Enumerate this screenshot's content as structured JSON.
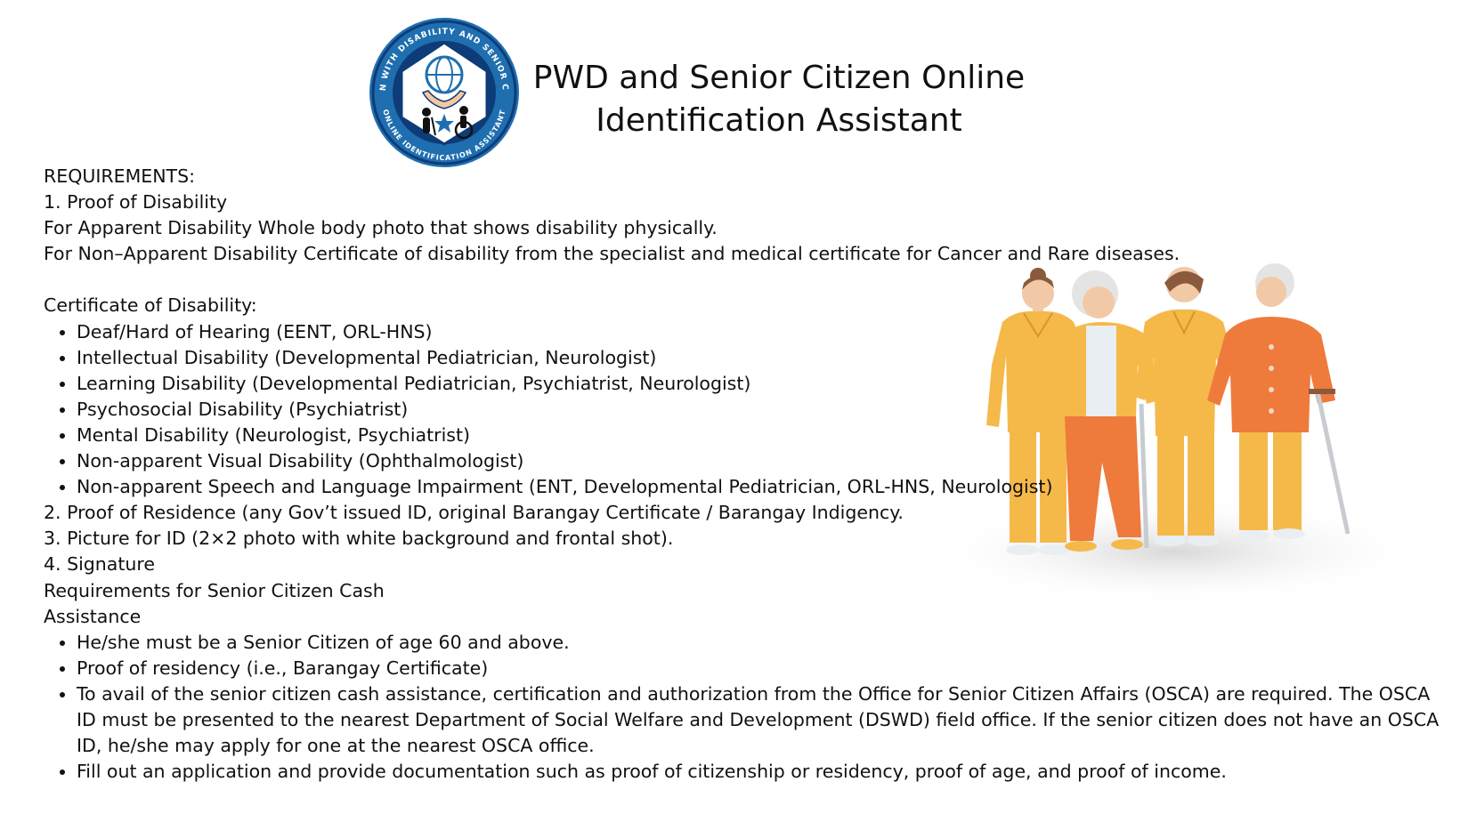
{
  "logo": {
    "ring_text_top": "PERSON WITH DISABILITY AND SENIOR CITIZEN",
    "ring_text_bottom": "ONLINE IDENTIFICATION ASSISTANT",
    "colors": {
      "ring": "#1f6fb0",
      "inner": "#0e3c78",
      "hexagon": "#ffffff",
      "hands": "#f4c9a0"
    }
  },
  "title": {
    "line1": "PWD and Senior Citizen Online",
    "line2": "Identification Assistant"
  },
  "requirements": {
    "heading": "REQUIREMENTS:",
    "item1": "1. Proof of Disability",
    "apparent": "For Apparent Disability Whole body photo that shows disability physically.",
    "non_apparent": "For Non–Apparent Disability Certificate of disability from the specialist and medical certificate for Cancer and Rare diseases.",
    "certificate_heading": "Certificate of Disability:",
    "certificate_items": [
      "Deaf/Hard of Hearing (EENT, ORL-HNS)",
      "Intellectual Disability (Developmental Pediatrician, Neurologist)",
      "Learning Disability (Developmental Pediatrician, Psychiatrist, Neurologist)",
      "Psychosocial Disability (Psychiatrist)",
      "Mental Disability (Neurologist, Psychiatrist)",
      "Non-apparent Visual Disability (Ophthalmologist)",
      "Non-apparent Speech and Language Impairment (ENT, Developmental Pediatrician, ORL-HNS, Neurologist)"
    ],
    "item2": "2. Proof of Residence (any Gov’t issued ID, original Barangay Certificate / Barangay Indigency.",
    "item3": "3. Picture for ID (2×2 photo with white background and frontal shot).",
    "item4": "4. Signature"
  },
  "senior": {
    "heading_line1": "Requirements for Senior Citizen Cash",
    "heading_line2": "Assistance",
    "items": [
      "He/she must be a Senior Citizen of age 60 and above.",
      "Proof of residency (i.e., Barangay Certificate)",
      "To avail of the senior citizen cash assistance, certification and authorization from the Office for Senior Citizen Affairs (OSCA) are required. The OSCA ID must be presented to the nearest Department of Social Welfare and Development (DSWD) field office. If the senior citizen does not have an OSCA ID, he/she may apply for one at the nearest OSCA office.",
      "Fill out an application and provide documentation such as proof of citizenship or residency, proof of age, and proof of income."
    ]
  },
  "illustration": {
    "icon": "caregivers-assisting-seniors-illustration",
    "colors": {
      "scrubs": "#f5b94a",
      "orange": "#ee7a3c",
      "hair_brown": "#8a5a3c",
      "hair_grey": "#e4e4e4",
      "cane": "#c8ccd0"
    }
  }
}
